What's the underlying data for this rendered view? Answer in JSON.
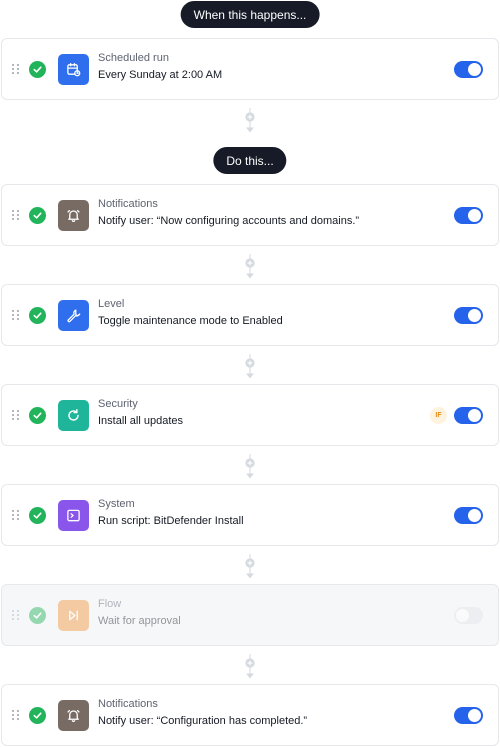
{
  "trigger_pill": {
    "label": "When this happens..."
  },
  "action_pill": {
    "label": "Do this..."
  },
  "trigger": {
    "label": "Scheduled run",
    "description": "Every Sunday at 2:00 AM",
    "icon": "calendar-clock-icon",
    "icon_color": "#2f6fed",
    "enabled": true
  },
  "steps": [
    {
      "label": "Notifications",
      "description": "Notify user: “Now configuring accounts and domains.”",
      "icon": "bell-icon",
      "icon_color": "#786b63",
      "enabled": true
    },
    {
      "label": "Level",
      "description": "Toggle maintenance mode to Enabled",
      "icon": "wrench-icon",
      "icon_color": "#2f6fed",
      "enabled": true
    },
    {
      "label": "Security",
      "description": "Install all updates",
      "icon": "refresh-icon",
      "icon_color": "#1fb59a",
      "enabled": true,
      "badge": "IF"
    },
    {
      "label": "System",
      "description": "Run script: BitDefender Install",
      "icon": "terminal-icon",
      "icon_color": "#8a55ea",
      "enabled": true
    },
    {
      "label": "Flow",
      "description": "Wait for approval",
      "icon": "skip-forward-icon",
      "icon_color": "#f2953a",
      "enabled": false
    },
    {
      "label": "Notifications",
      "description": "Notify user: “Configuration has completed.”",
      "icon": "bell-icon",
      "icon_color": "#786b63",
      "enabled": true
    }
  ],
  "colors": {
    "accent": "#2563eb",
    "success": "#22b45a",
    "pill_bg": "#161b27"
  }
}
